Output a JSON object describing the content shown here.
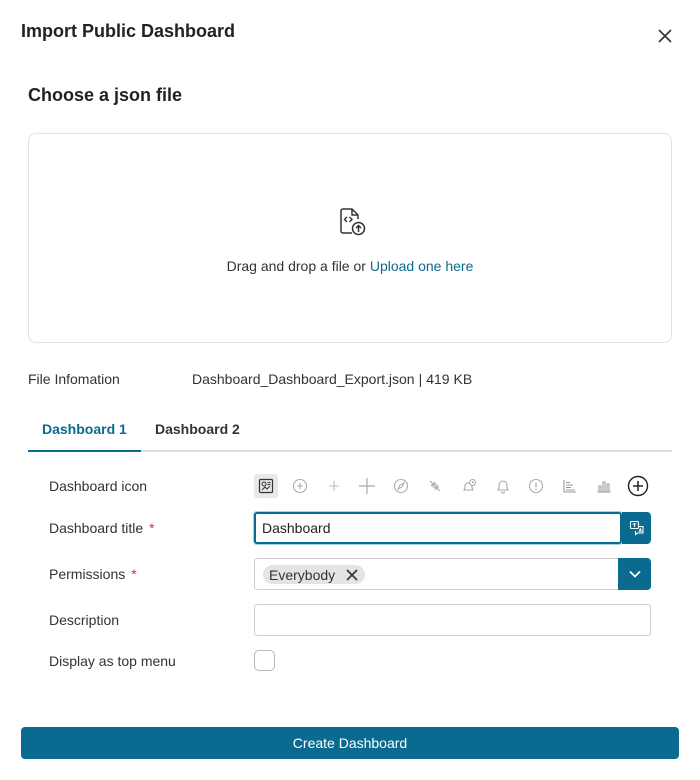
{
  "dialog": {
    "title": "Import Public Dashboard"
  },
  "upload": {
    "section_title": "Choose a json file",
    "drop_text": "Drag and drop a file or ",
    "link_text": "Upload one here"
  },
  "file_info": {
    "label": "File Infomation",
    "file_name": "Dashboard_Dashboard_Export.json",
    "separator": "|",
    "file_size": "419 KB"
  },
  "tabs": [
    {
      "label": "Dashboard 1",
      "active": true
    },
    {
      "label": "Dashboard 2",
      "active": false
    }
  ],
  "form": {
    "icon_label": "Dashboard icon",
    "icons": [
      "dashboard-icon",
      "circle-plus-icon",
      "plus-small-icon",
      "plus-icon",
      "compass-icon",
      "satellite-icon",
      "bell-clock-icon",
      "bell-icon",
      "alert-circle-icon",
      "bar-chart-horizontal-icon",
      "bar-chart-icon",
      "add-circle-icon"
    ],
    "title_label": "Dashboard title",
    "title_value": "Dashboard",
    "required_mark": "*",
    "permissions_label": "Permissions",
    "permissions_chip": "Everybody",
    "description_label": "Description",
    "description_value": "",
    "top_menu_label": "Display as top menu"
  },
  "footer": {
    "create_label": "Create Dashboard"
  },
  "colors": {
    "accent": "#0b6a8f",
    "required": "#d0332f"
  }
}
